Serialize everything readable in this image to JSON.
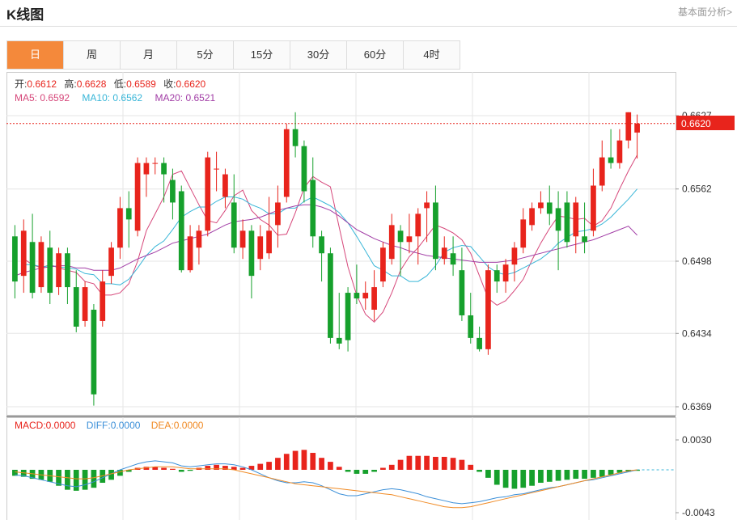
{
  "header": {
    "title": "K线图",
    "link": "基本面分析>"
  },
  "tabs": [
    {
      "label": "日",
      "active": true
    },
    {
      "label": "周",
      "active": false
    },
    {
      "label": "月",
      "active": false
    },
    {
      "label": "5分",
      "active": false
    },
    {
      "label": "15分",
      "active": false
    },
    {
      "label": "30分",
      "active": false
    },
    {
      "label": "60分",
      "active": false
    },
    {
      "label": "4时",
      "active": false
    }
  ],
  "ohlc_info": {
    "open_label": "开:",
    "open": "0.6612",
    "high_label": "高:",
    "high": "0.6628",
    "low_label": "低:",
    "low": "0.6589",
    "close_label": "收:",
    "close": "0.6620"
  },
  "ma_info": {
    "ma5_label": "MA5: ",
    "ma5": "0.6592",
    "ma10_label": "MA10: ",
    "ma10": "0.6562",
    "ma20_label": "MA20: ",
    "ma20": "0.6521"
  },
  "macd_info": {
    "macd_label": "MACD:",
    "macd": "0.0000",
    "diff_label": "DIFF:",
    "diff": "0.0000",
    "dea_label": "DEA:",
    "dea": "0.0000"
  },
  "colors": {
    "up": "#e8241c",
    "down": "#16a02c",
    "ma5": "#d6477a",
    "ma10": "#39b6d8",
    "ma20": "#a23ea6",
    "dea": "#f08a24",
    "diff": "#3b8fd8",
    "tab_active": "#f4893b"
  },
  "chart_data": {
    "type": "candlestick",
    "y_ticks": [
      "0.6627",
      "0.6562",
      "0.6498",
      "0.6434",
      "0.6369"
    ],
    "ylim": [
      0.6369,
      0.6627
    ],
    "current_price": "0.6620",
    "candles": [
      [
        0.652,
        0.648,
        0.653,
        0.6465
      ],
      [
        0.6485,
        0.6525,
        0.6535,
        0.647
      ],
      [
        0.6515,
        0.647,
        0.654,
        0.6465
      ],
      [
        0.6475,
        0.6515,
        0.652,
        0.647
      ],
      [
        0.651,
        0.647,
        0.6525,
        0.646
      ],
      [
        0.6475,
        0.6505,
        0.651,
        0.6468
      ],
      [
        0.6505,
        0.6475,
        0.651,
        0.646
      ],
      [
        0.6475,
        0.644,
        0.649,
        0.6435
      ],
      [
        0.6445,
        0.6475,
        0.648,
        0.644
      ],
      [
        0.6455,
        0.638,
        0.646,
        0.637
      ],
      [
        0.6445,
        0.648,
        0.649,
        0.644
      ],
      [
        0.6485,
        0.651,
        0.6515,
        0.6478
      ],
      [
        0.651,
        0.6545,
        0.6555,
        0.65
      ],
      [
        0.6545,
        0.6535,
        0.656,
        0.651
      ],
      [
        0.6525,
        0.6585,
        0.659,
        0.652
      ],
      [
        0.6575,
        0.6585,
        0.659,
        0.6555
      ],
      [
        0.6585,
        0.6585,
        0.659,
        0.6575
      ],
      [
        0.6585,
        0.6575,
        0.659,
        0.655
      ],
      [
        0.657,
        0.655,
        0.658,
        0.6535
      ],
      [
        0.656,
        0.649,
        0.6565,
        0.6488
      ],
      [
        0.649,
        0.652,
        0.653,
        0.6488
      ],
      [
        0.651,
        0.6525,
        0.653,
        0.6495
      ],
      [
        0.6525,
        0.659,
        0.6595,
        0.652
      ],
      [
        0.658,
        0.658,
        0.6595,
        0.656
      ],
      [
        0.6555,
        0.6575,
        0.658,
        0.6545
      ],
      [
        0.655,
        0.651,
        0.6575,
        0.6505
      ],
      [
        0.651,
        0.6525,
        0.6535,
        0.65
      ],
      [
        0.6525,
        0.6485,
        0.653,
        0.6465
      ],
      [
        0.65,
        0.652,
        0.653,
        0.649
      ],
      [
        0.6505,
        0.6525,
        0.6555,
        0.65
      ],
      [
        0.653,
        0.655,
        0.6565,
        0.651
      ],
      [
        0.6555,
        0.6615,
        0.662,
        0.655
      ],
      [
        0.6615,
        0.66,
        0.663,
        0.659
      ],
      [
        0.66,
        0.656,
        0.6605,
        0.655
      ],
      [
        0.657,
        0.652,
        0.659,
        0.651
      ],
      [
        0.652,
        0.6505,
        0.6525,
        0.648
      ],
      [
        0.6505,
        0.643,
        0.651,
        0.6425
      ],
      [
        0.643,
        0.6425,
        0.647,
        0.642
      ],
      [
        0.647,
        0.6428,
        0.6475,
        0.6418
      ],
      [
        0.647,
        0.6465,
        0.6495,
        0.646
      ],
      [
        0.6465,
        0.647,
        0.648,
        0.6455
      ],
      [
        0.6455,
        0.6475,
        0.649,
        0.6445
      ],
      [
        0.648,
        0.651,
        0.6515,
        0.6475
      ],
      [
        0.65,
        0.653,
        0.654,
        0.6495
      ],
      [
        0.6525,
        0.6515,
        0.653,
        0.6485
      ],
      [
        0.6515,
        0.652,
        0.654,
        0.6505
      ],
      [
        0.652,
        0.654,
        0.6545,
        0.6495
      ],
      [
        0.6545,
        0.655,
        0.656,
        0.6515
      ],
      [
        0.655,
        0.65,
        0.6565,
        0.649
      ],
      [
        0.65,
        0.651,
        0.652,
        0.6495
      ],
      [
        0.6505,
        0.6495,
        0.652,
        0.6485
      ],
      [
        0.649,
        0.645,
        0.651,
        0.6445
      ],
      [
        0.645,
        0.643,
        0.647,
        0.6425
      ],
      [
        0.643,
        0.642,
        0.644,
        0.6418
      ],
      [
        0.642,
        0.649,
        0.6495,
        0.6415
      ],
      [
        0.649,
        0.648,
        0.6495,
        0.647
      ],
      [
        0.648,
        0.6495,
        0.65,
        0.647
      ],
      [
        0.6495,
        0.651,
        0.6515,
        0.648
      ],
      [
        0.651,
        0.6535,
        0.6545,
        0.6505
      ],
      [
        0.653,
        0.6545,
        0.655,
        0.6525
      ],
      [
        0.6545,
        0.655,
        0.656,
        0.654
      ],
      [
        0.655,
        0.654,
        0.6565,
        0.653
      ],
      [
        0.6545,
        0.6525,
        0.656,
        0.649
      ],
      [
        0.655,
        0.6515,
        0.656,
        0.651
      ],
      [
        0.652,
        0.655,
        0.6555,
        0.6505
      ],
      [
        0.652,
        0.6515,
        0.655,
        0.6505
      ],
      [
        0.6525,
        0.6565,
        0.658,
        0.652
      ],
      [
        0.6565,
        0.659,
        0.6605,
        0.656
      ],
      [
        0.659,
        0.6585,
        0.6615,
        0.658
      ],
      [
        0.6585,
        0.6605,
        0.6615,
        0.658
      ],
      [
        0.6605,
        0.663,
        0.663,
        0.6598
      ],
      [
        0.6612,
        0.662,
        0.6628,
        0.6589
      ]
    ],
    "ma5": [
      0.65,
      0.6495,
      0.6492,
      0.6495,
      0.6492,
      0.649,
      0.6488,
      0.648,
      0.6478,
      0.6468,
      0.6468,
      0.647,
      0.6478,
      0.6498,
      0.6525,
      0.654,
      0.6555,
      0.6575,
      0.6578,
      0.6563,
      0.6548,
      0.6534,
      0.6532,
      0.6543,
      0.6556,
      0.6561,
      0.6543,
      0.6535,
      0.653,
      0.6521,
      0.6522,
      0.6541,
      0.6563,
      0.6573,
      0.6568,
      0.6564,
      0.6528,
      0.6493,
      0.6468,
      0.6451,
      0.6444,
      0.6453,
      0.647,
      0.649,
      0.6502,
      0.651,
      0.652,
      0.653,
      0.6527,
      0.6523,
      0.6517,
      0.6505,
      0.6485,
      0.6465,
      0.6459,
      0.6463,
      0.6472,
      0.6482,
      0.6499,
      0.6514,
      0.6527,
      0.6538,
      0.6537,
      0.6535,
      0.6536,
      0.6529,
      0.6534,
      0.6545,
      0.6562,
      0.6578,
      0.6592
    ],
    "ma10": [
      0.6495,
      0.6495,
      0.6493,
      0.6494,
      0.6493,
      0.6492,
      0.6491,
      0.6487,
      0.6486,
      0.6478,
      0.6478,
      0.6477,
      0.6482,
      0.6492,
      0.6503,
      0.6511,
      0.6516,
      0.6526,
      0.6537,
      0.6542,
      0.6546,
      0.6546,
      0.6551,
      0.6555,
      0.6555,
      0.6553,
      0.6548,
      0.6545,
      0.654,
      0.654,
      0.6545,
      0.6545,
      0.6551,
      0.6555,
      0.6551,
      0.6547,
      0.6541,
      0.6532,
      0.652,
      0.6507,
      0.6494,
      0.649,
      0.6485,
      0.6485,
      0.648,
      0.648,
      0.6485,
      0.6494,
      0.6506,
      0.651,
      0.6512,
      0.6511,
      0.6502,
      0.6493,
      0.6488,
      0.6486,
      0.6488,
      0.6492,
      0.6496,
      0.65,
      0.6506,
      0.6514,
      0.6519,
      0.6524,
      0.6525,
      0.6527,
      0.6531,
      0.6537,
      0.6545,
      0.6553,
      0.6562
    ],
    "ma20": [
      0.6485,
      0.6488,
      0.649,
      0.6492,
      0.6493,
      0.6494,
      0.6494,
      0.6492,
      0.6492,
      0.649,
      0.649,
      0.649,
      0.6492,
      0.6496,
      0.65,
      0.6503,
      0.6506,
      0.651,
      0.6514,
      0.6516,
      0.6518,
      0.652,
      0.6522,
      0.6526,
      0.653,
      0.6533,
      0.6534,
      0.6535,
      0.6537,
      0.654,
      0.6543,
      0.6545,
      0.6547,
      0.6548,
      0.6548,
      0.6546,
      0.6543,
      0.6538,
      0.6532,
      0.6526,
      0.6522,
      0.6518,
      0.6515,
      0.6512,
      0.651,
      0.6507,
      0.6505,
      0.6503,
      0.6502,
      0.6501,
      0.65,
      0.6499,
      0.6498,
      0.6497,
      0.6497,
      0.6497,
      0.6498,
      0.6499,
      0.6501,
      0.6503,
      0.6505,
      0.6507,
      0.6509,
      0.6511,
      0.6513,
      0.6515,
      0.6517,
      0.652,
      0.6523,
      0.6526,
      0.6529,
      0.6521
    ],
    "macd_ticks": [
      "0.0030",
      "-0.0043"
    ],
    "macd_ylim": [
      -0.0043,
      0.003
    ],
    "macd_hist": [
      -0.0006,
      -0.0007,
      -0.0009,
      -0.001,
      -0.0012,
      -0.0016,
      -0.002,
      -0.0021,
      -0.002,
      -0.0018,
      -0.0013,
      -0.001,
      -0.0006,
      -0.0002,
      0.0002,
      0.0003,
      0.0003,
      0.0002,
      0.0001,
      -0.0002,
      -0.0001,
      0.0002,
      0.0004,
      0.0005,
      0.0004,
      0.0003,
      0.0002,
      0.0004,
      0.0006,
      0.0008,
      0.0012,
      0.0016,
      0.0019,
      0.002,
      0.0017,
      0.0012,
      0.0008,
      0.0003,
      -0.0002,
      -0.0004,
      -0.0004,
      -0.0002,
      0.0002,
      0.0005,
      0.001,
      0.0014,
      0.0014,
      0.0014,
      0.0013,
      0.0013,
      0.0012,
      0.001,
      0.0005,
      -0.0002,
      -0.0008,
      -0.0015,
      -0.0018,
      -0.0019,
      -0.0018,
      -0.0016,
      -0.0013,
      -0.0012,
      -0.0011,
      -0.001,
      -0.0009,
      -0.0009,
      -0.0008,
      -0.0007,
      -0.0005,
      -0.0003,
      -0.0002,
      -0.0001
    ],
    "diff": [
      -0.0005,
      -0.0006,
      -0.0008,
      -0.001,
      -0.0012,
      -0.0014,
      -0.0016,
      -0.0017,
      -0.0015,
      -0.0012,
      -0.0008,
      -0.0004,
      0.0,
      0.0003,
      0.0006,
      0.0008,
      0.0009,
      0.0008,
      0.0007,
      0.0004,
      0.0003,
      0.0004,
      0.0005,
      0.0006,
      0.0006,
      0.0005,
      0.0003,
      0.0,
      -0.0004,
      -0.0008,
      -0.0011,
      -0.0013,
      -0.0013,
      -0.0012,
      -0.0013,
      -0.0016,
      -0.002,
      -0.0024,
      -0.0026,
      -0.0026,
      -0.0024,
      -0.0022,
      -0.002,
      -0.0019,
      -0.002,
      -0.0022,
      -0.0024,
      -0.0027,
      -0.0029,
      -0.0031,
      -0.0033,
      -0.0034,
      -0.0033,
      -0.0032,
      -0.003,
      -0.0028,
      -0.0027,
      -0.0025,
      -0.0024,
      -0.0022,
      -0.002,
      -0.0018,
      -0.0017,
      -0.0015,
      -0.0013,
      -0.0011,
      -0.001,
      -0.0008,
      -0.0006,
      -0.0004,
      -0.0002,
      0.0
    ],
    "dea": [
      -0.0002,
      -0.0003,
      -0.0004,
      -0.0005,
      -0.0006,
      -0.0007,
      -0.0008,
      -0.0009,
      -0.0009,
      -0.0008,
      -0.0006,
      -0.0004,
      -0.0002,
      0.0,
      0.0001,
      0.0002,
      0.0003,
      0.0003,
      0.0003,
      0.0002,
      0.0001,
      0.0001,
      0.0001,
      0.0001,
      0.0001,
      0.0,
      -0.0002,
      -0.0004,
      -0.0006,
      -0.0008,
      -0.001,
      -0.0012,
      -0.0014,
      -0.0015,
      -0.0016,
      -0.0017,
      -0.0018,
      -0.0019,
      -0.002,
      -0.0021,
      -0.0022,
      -0.0023,
      -0.0024,
      -0.0025,
      -0.0027,
      -0.0029,
      -0.0031,
      -0.0033,
      -0.0035,
      -0.0037,
      -0.0038,
      -0.0038,
      -0.0037,
      -0.0035,
      -0.0033,
      -0.0031,
      -0.0029,
      -0.0027,
      -0.0025,
      -0.0023,
      -0.0021,
      -0.0019,
      -0.0017,
      -0.0015,
      -0.0013,
      -0.0011,
      -0.0009,
      -0.0007,
      -0.0005,
      -0.0003,
      -0.0001,
      0.0
    ]
  }
}
